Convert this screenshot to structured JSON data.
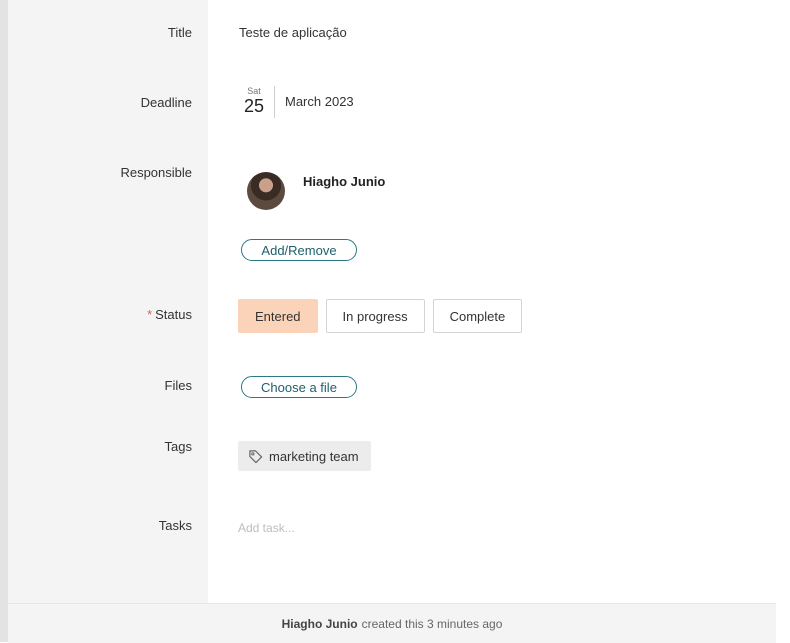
{
  "fields": {
    "title": {
      "label": "Title",
      "value": "Teste de aplicação"
    },
    "deadline": {
      "label": "Deadline",
      "dow": "Sat",
      "day": "25",
      "month_year": "March 2023"
    },
    "responsible": {
      "label": "Responsible",
      "name": "Hiagho Junio",
      "add_remove_label": "Add/Remove"
    },
    "status": {
      "required_mark": "*",
      "label": "Status",
      "options": [
        "Entered",
        "In progress",
        "Complete"
      ],
      "selected": "Entered",
      "active_color": "#fbd3b8"
    },
    "files": {
      "label": "Files",
      "button_label": "Choose a file"
    },
    "tags": {
      "label": "Tags",
      "items": [
        "marketing team"
      ],
      "icon": "tag-icon"
    },
    "tasks": {
      "label": "Tasks",
      "placeholder": "Add task..."
    }
  },
  "footer": {
    "author": "Hiagho Junio",
    "text": "created this 3 minutes ago"
  },
  "colors": {
    "accent": "#2a7a86",
    "required": "#e25c4d",
    "label_bg": "#f4f4f4"
  }
}
